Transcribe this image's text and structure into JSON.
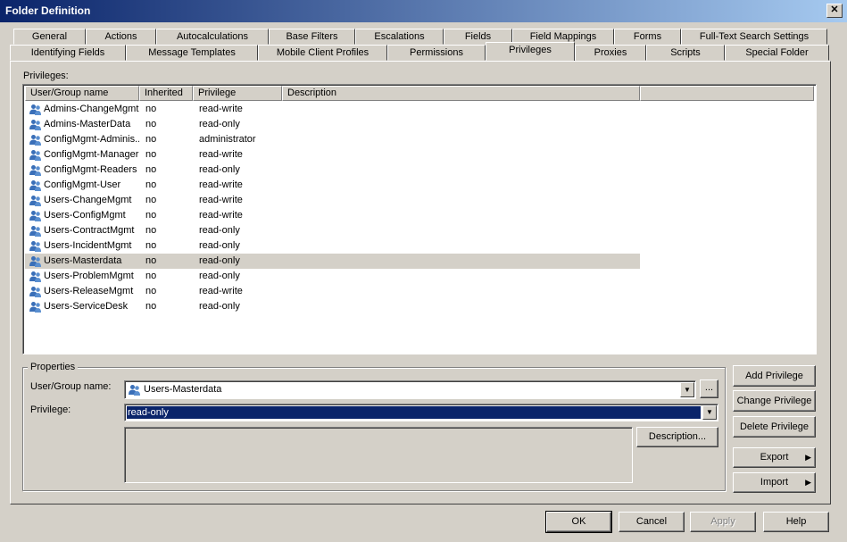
{
  "window": {
    "title": "Folder Definition",
    "close_label": "✕"
  },
  "tabs": {
    "row_top": [
      "General",
      "Actions",
      "Autocalculations",
      "Base Filters",
      "Escalations",
      "Fields",
      "Field Mappings",
      "Forms",
      "Full-Text Search Settings"
    ],
    "row_bottom": [
      "Identifying Fields",
      "Message Templates",
      "Mobile Client Profiles",
      "Permissions",
      "Privileges",
      "Proxies",
      "Scripts",
      "Special Folder"
    ],
    "active": "Privileges"
  },
  "privileges": {
    "label": "Privileges:",
    "columns": [
      "User/Group name",
      "Inherited",
      "Privilege",
      "Description"
    ],
    "rows": [
      {
        "name": "Admins-ChangeMgmt",
        "inherited": "no",
        "privilege": "read-write",
        "description": ""
      },
      {
        "name": "Admins-MasterData",
        "inherited": "no",
        "privilege": "read-only",
        "description": ""
      },
      {
        "name": "ConfigMgmt-Adminis...",
        "inherited": "no",
        "privilege": "administrator",
        "description": ""
      },
      {
        "name": "ConfigMgmt-Manager",
        "inherited": "no",
        "privilege": "read-write",
        "description": ""
      },
      {
        "name": "ConfigMgmt-Readers",
        "inherited": "no",
        "privilege": "read-only",
        "description": ""
      },
      {
        "name": "ConfigMgmt-User",
        "inherited": "no",
        "privilege": "read-write",
        "description": ""
      },
      {
        "name": "Users-ChangeMgmt",
        "inherited": "no",
        "privilege": "read-write",
        "description": ""
      },
      {
        "name": "Users-ConfigMgmt",
        "inherited": "no",
        "privilege": "read-write",
        "description": ""
      },
      {
        "name": "Users-ContractMgmt",
        "inherited": "no",
        "privilege": "read-only",
        "description": ""
      },
      {
        "name": "Users-IncidentMgmt",
        "inherited": "no",
        "privilege": "read-only",
        "description": ""
      },
      {
        "name": "Users-Masterdata",
        "inherited": "no",
        "privilege": "read-only",
        "description": "",
        "selected": true
      },
      {
        "name": "Users-ProblemMgmt",
        "inherited": "no",
        "privilege": "read-only",
        "description": ""
      },
      {
        "name": "Users-ReleaseMgmt",
        "inherited": "no",
        "privilege": "read-write",
        "description": ""
      },
      {
        "name": "Users-ServiceDesk",
        "inherited": "no",
        "privilege": "read-only",
        "description": ""
      }
    ]
  },
  "properties": {
    "group_label": "Properties",
    "user_group_label": "User/Group name:",
    "user_group_value": "Users-Masterdata",
    "browse_label": "...",
    "privilege_label": "Privilege:",
    "privilege_value": "read-only",
    "description_button": "Description...",
    "description_value": ""
  },
  "side_buttons": {
    "add": "Add Privilege",
    "change": "Change Privilege",
    "delete": "Delete Privilege",
    "export": "Export",
    "import": "Import"
  },
  "footer": {
    "ok": "OK",
    "cancel": "Cancel",
    "apply": "Apply",
    "help": "Help"
  },
  "colors": {
    "titlebar_start": "#0a246a",
    "titlebar_end": "#a6caf0",
    "selection": "#0a246a",
    "face": "#d4d0c8",
    "user_icon": "#3a6fb8"
  }
}
